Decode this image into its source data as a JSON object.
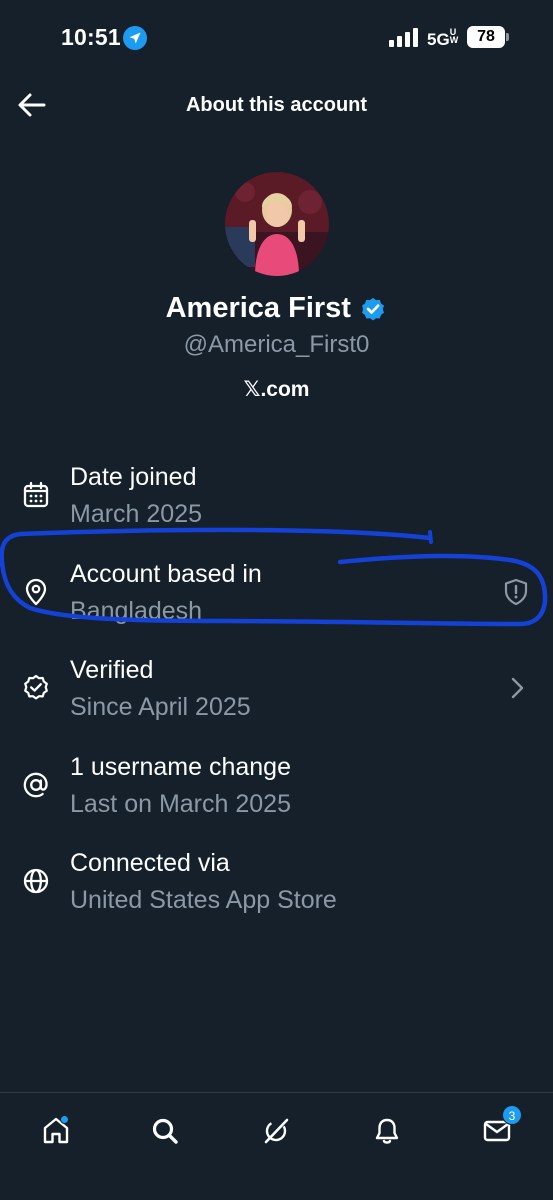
{
  "status_bar": {
    "time": "10:51",
    "network": "5G",
    "battery": "78"
  },
  "header": {
    "title": "About this account"
  },
  "profile": {
    "display_name": "America First",
    "handle": "@America_First0",
    "site_mark": "𝕏",
    "site_suffix": ".com",
    "verified": true
  },
  "info_items": [
    {
      "icon": "calendar-icon",
      "title": "Date joined",
      "subtitle": "March 2025"
    },
    {
      "icon": "location-pin-icon",
      "title": "Account based in",
      "subtitle": "Bangladesh",
      "trailing": "shield-alert-icon"
    },
    {
      "icon": "verified-check-icon",
      "title": "Verified",
      "subtitle": "Since April 2025",
      "trailing": "chevron-right-icon"
    },
    {
      "icon": "at-sign-icon",
      "title": "1 username change",
      "subtitle": "Last on March 2025"
    },
    {
      "icon": "globe-icon",
      "title": "Connected via",
      "subtitle": "United States App Store"
    }
  ],
  "tab_bar": {
    "tabs": [
      "home",
      "search",
      "grok",
      "notifications",
      "messages"
    ],
    "messages_badge": "3"
  },
  "colors": {
    "background": "#15202b",
    "accent": "#1d9bf0",
    "secondary_text": "#8b98a5",
    "annotation_stroke": "#1442d6"
  }
}
